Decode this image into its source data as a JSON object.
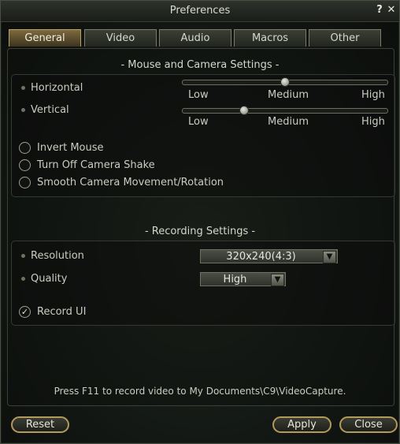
{
  "window": {
    "title": "Preferences",
    "help_glyph": "?",
    "close_glyph": "✕"
  },
  "tabs": [
    "General",
    "Video",
    "Audio",
    "Macros",
    "Other"
  ],
  "active_tab": "General",
  "mouse": {
    "section_title": "- Mouse and Camera Settings -",
    "horizontal": {
      "label": "Horizontal",
      "value_fraction": 0.5,
      "ticks": [
        "Low",
        "Medium",
        "High"
      ]
    },
    "vertical": {
      "label": "Vertical",
      "value_fraction": 0.3,
      "ticks": [
        "Low",
        "Medium",
        "High"
      ]
    },
    "options": [
      "Invert Mouse",
      "Turn Off Camera Shake",
      "Smooth Camera Movement/Rotation"
    ]
  },
  "recording": {
    "section_title": "- Recording Settings -",
    "resolution": {
      "label": "Resolution",
      "value": "320x240(4:3)"
    },
    "quality": {
      "label": "Quality",
      "value": "High"
    },
    "record_ui": {
      "label": "Record UI",
      "checked": true,
      "check_glyph": "✓"
    }
  },
  "hint": "Press F11 to record video to My Documents\\C9\\VideoCapture.",
  "buttons": {
    "reset": "Reset",
    "apply": "Apply",
    "close": "Close"
  },
  "colors": {
    "accent_gold": "#b39a5c",
    "active_tab": "#7d6a3e"
  }
}
